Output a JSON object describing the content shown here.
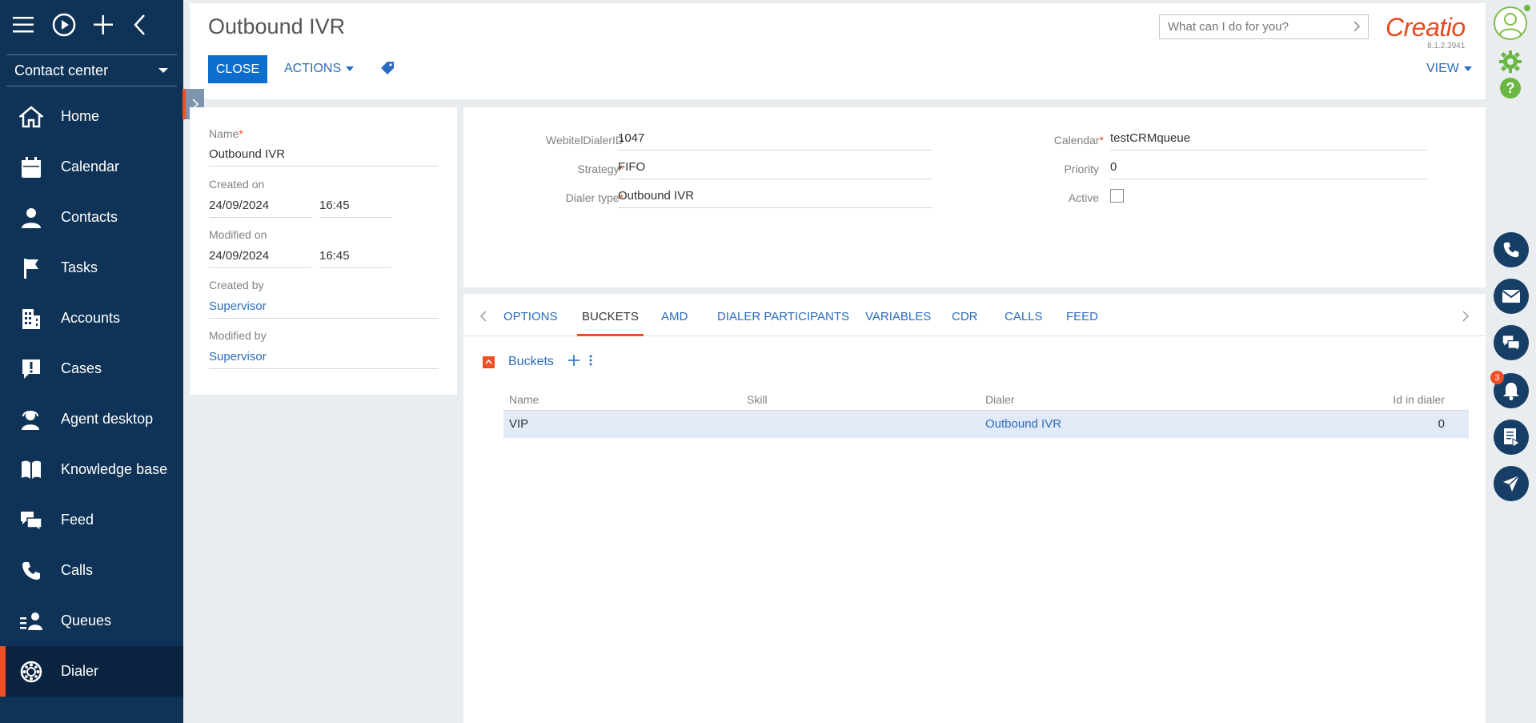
{
  "sidebar": {
    "workspace": "Contact center",
    "items": [
      {
        "label": "Home",
        "icon": "home-icon"
      },
      {
        "label": "Calendar",
        "icon": "calendar-icon"
      },
      {
        "label": "Contacts",
        "icon": "person-icon"
      },
      {
        "label": "Tasks",
        "icon": "flag-icon"
      },
      {
        "label": "Accounts",
        "icon": "building-icon"
      },
      {
        "label": "Cases",
        "icon": "alert-bubble-icon"
      },
      {
        "label": "Agent desktop",
        "icon": "agent-icon"
      },
      {
        "label": "Knowledge base",
        "icon": "book-icon"
      },
      {
        "label": "Feed",
        "icon": "chat-icon"
      },
      {
        "label": "Calls",
        "icon": "phone-icon"
      },
      {
        "label": "Queues",
        "icon": "queue-icon"
      },
      {
        "label": "Dialer",
        "icon": "dialer-icon"
      }
    ]
  },
  "header": {
    "title": "Outbound IVR",
    "close_label": "CLOSE",
    "actions_label": "ACTIONS",
    "search_placeholder": "What can I do for you?",
    "logo": "Creatio",
    "version": "8.1.2.3941",
    "view_label": "VIEW"
  },
  "info": {
    "name_label": "Name",
    "name_value": "Outbound IVR",
    "created_on_label": "Created on",
    "created_date": "24/09/2024",
    "created_time": "16:45",
    "modified_on_label": "Modified on",
    "modified_date": "24/09/2024",
    "modified_time": "16:45",
    "created_by_label": "Created by",
    "created_by": "Supervisor",
    "modified_by_label": "Modified by",
    "modified_by": "Supervisor"
  },
  "fields": {
    "dialer_id_label": "WebitelDialerID",
    "dialer_id": "1047",
    "strategy_label": "Strategy",
    "strategy": "FIFO",
    "dialer_type_label": "Dialer type",
    "dialer_type": "Outbound IVR",
    "calendar_label": "Calendar",
    "calendar": "testCRMqueue",
    "priority_label": "Priority",
    "priority": "0",
    "active_label": "Active",
    "active": false
  },
  "tabs": [
    "OPTIONS",
    "BUCKETS",
    "AMD",
    "DIALER PARTICIPANTS",
    "VARIABLES",
    "CDR",
    "CALLS",
    "FEED"
  ],
  "active_tab": "BUCKETS",
  "buckets": {
    "title": "Buckets",
    "columns": [
      "Name",
      "Skill",
      "Dialer",
      "Id in dialer"
    ],
    "rows": [
      {
        "name": "VIP",
        "skill": "",
        "dialer": "Outbound IVR",
        "id": "0"
      }
    ]
  },
  "rail": {
    "notification_count": "3"
  },
  "colors": {
    "sidebar": "#0f3356",
    "accent": "#f04f23",
    "primary": "#0d6ecf",
    "link": "#2a6dc0"
  }
}
